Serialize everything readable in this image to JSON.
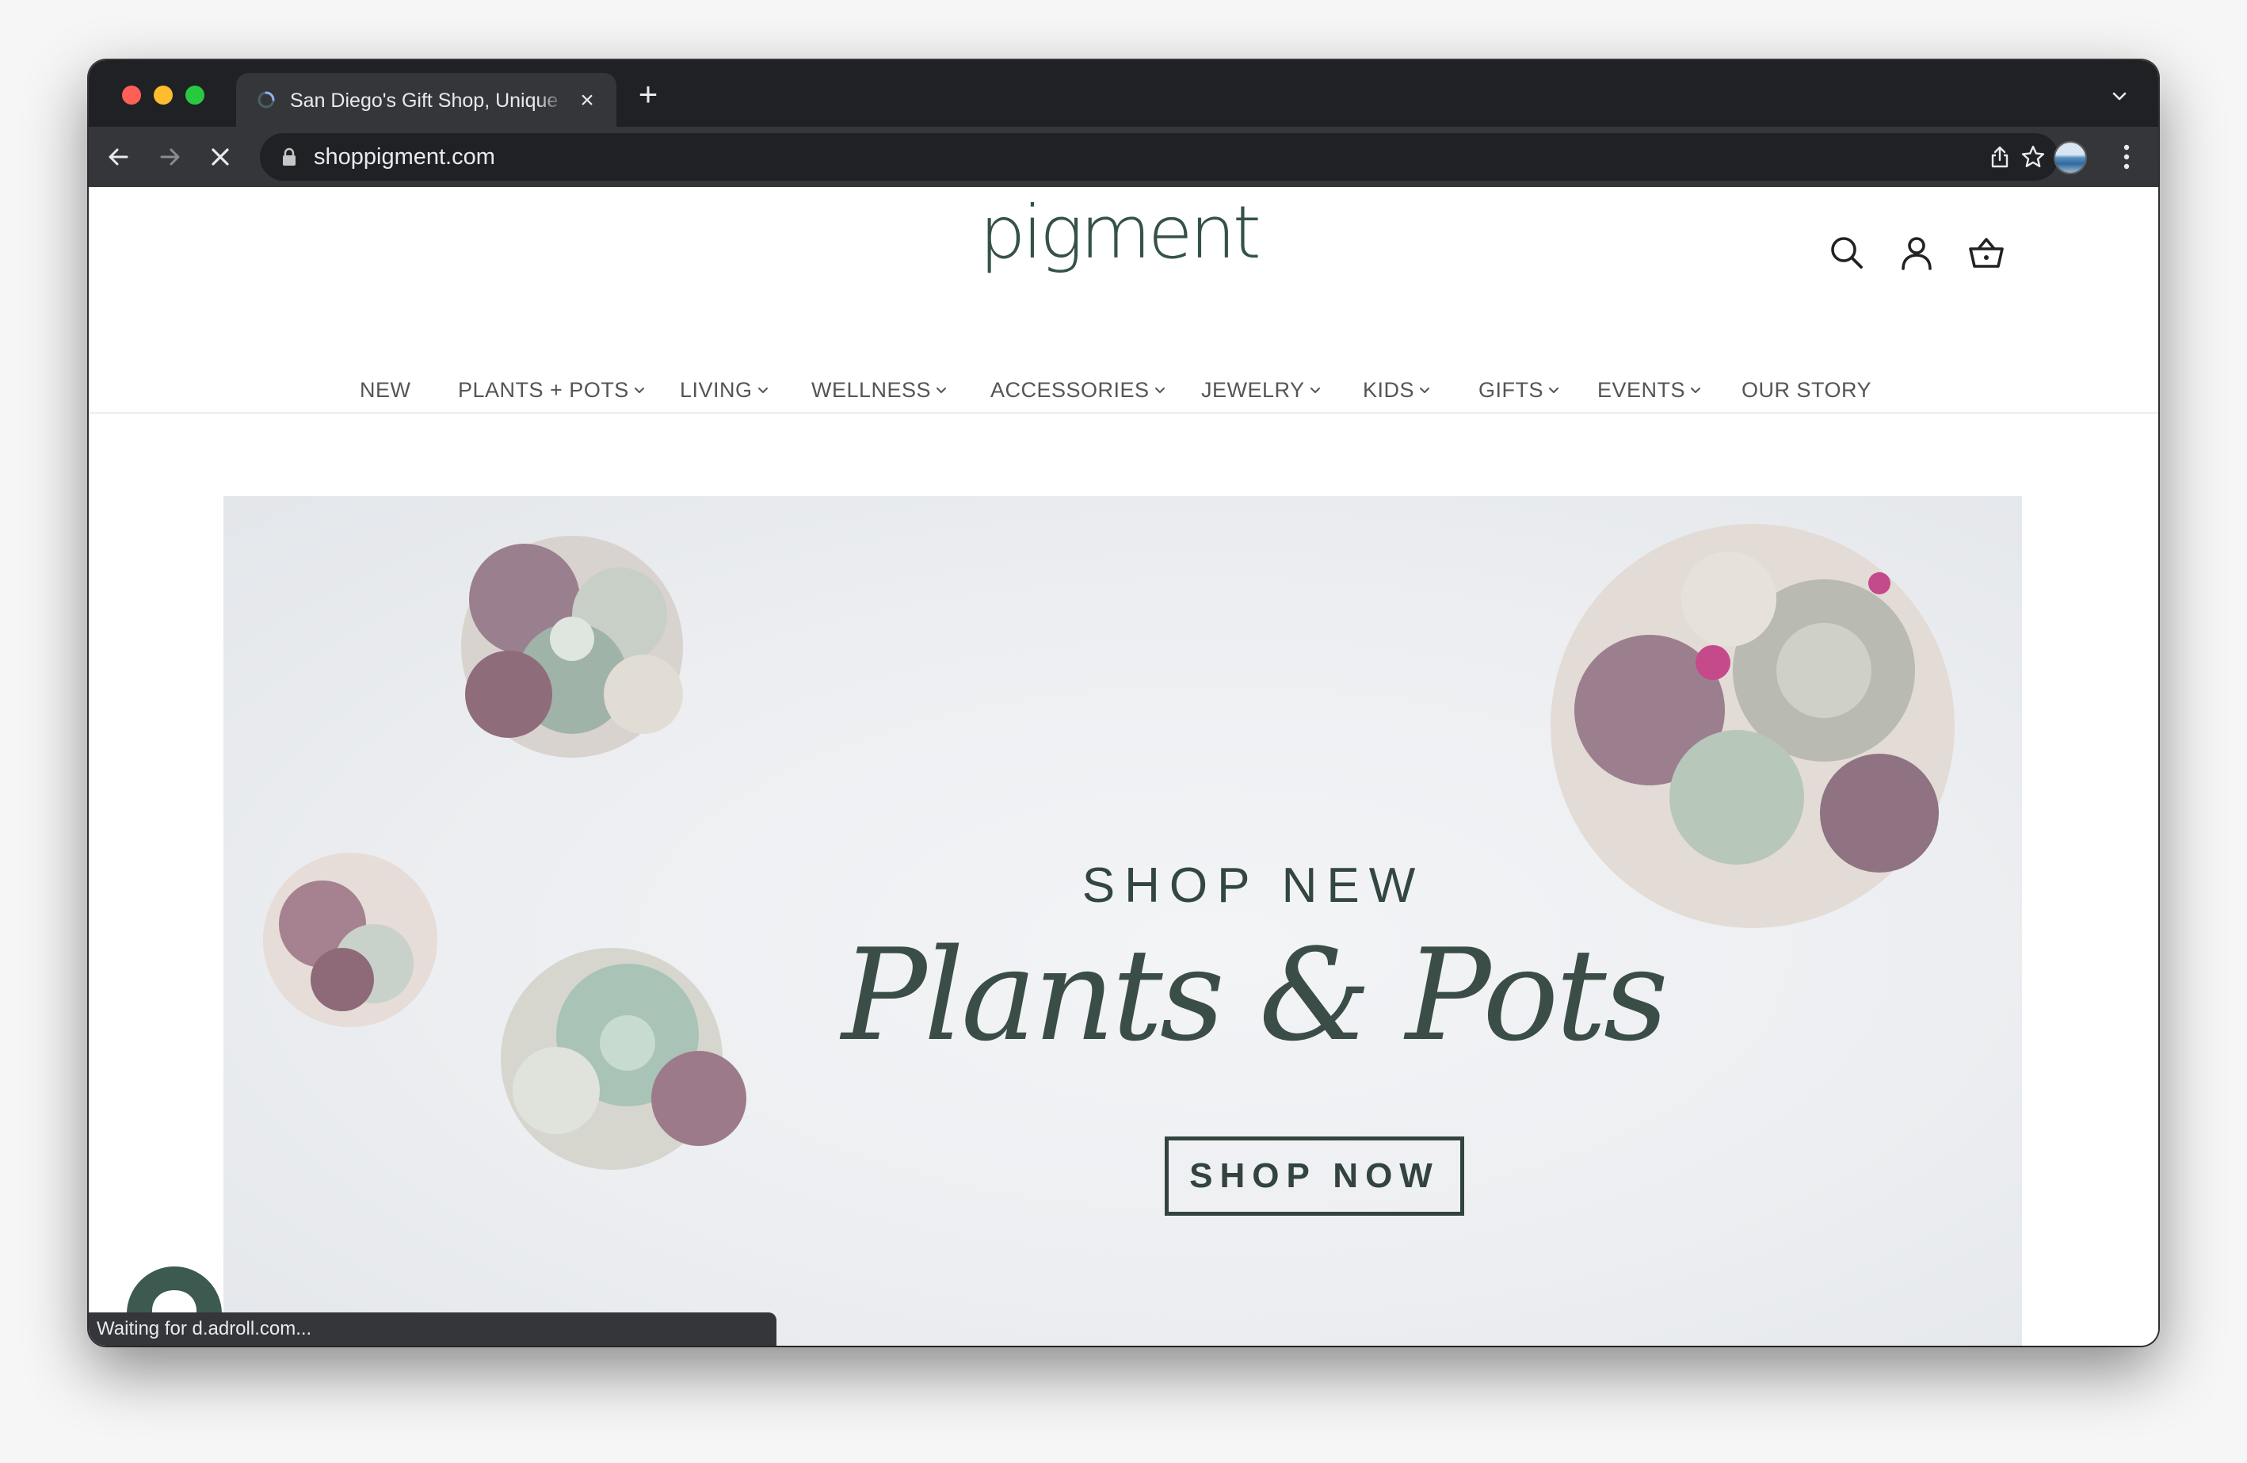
{
  "browser": {
    "tab": {
      "title": "San Diego's Gift Shop, Unique",
      "close_glyph": "×"
    },
    "new_tab_glyph": "+",
    "address_bar": {
      "url": "shoppigment.com"
    },
    "status_bar": "Waiting for d.adroll.com...",
    "icons": [
      "back-icon",
      "forward-icon",
      "stop-loading-icon",
      "lock-icon",
      "share-icon",
      "bookmark-star-icon",
      "profile-avatar",
      "more-menu-icon",
      "tab-search-icon",
      "loading-favicon"
    ]
  },
  "site": {
    "logo": "pigment",
    "header_icons": [
      "search-icon",
      "account-icon",
      "cart-basket-icon"
    ],
    "nav": [
      {
        "label": "NEW",
        "dropdown": false
      },
      {
        "label": "PLANTS + POTS",
        "dropdown": true
      },
      {
        "label": "LIVING",
        "dropdown": true
      },
      {
        "label": "WELLNESS",
        "dropdown": true
      },
      {
        "label": "ACCESSORIES",
        "dropdown": true
      },
      {
        "label": "JEWELRY",
        "dropdown": true
      },
      {
        "label": "KIDS",
        "dropdown": true
      },
      {
        "label": "GIFTS",
        "dropdown": true
      },
      {
        "label": "EVENTS",
        "dropdown": true
      },
      {
        "label": "OUR STORY",
        "dropdown": false
      }
    ],
    "hero": {
      "subtitle": "SHOP NEW",
      "title": "Plants & Pots",
      "button": "SHOP NOW"
    },
    "chat_widget_icon": "chat-bubble-icon",
    "colors": {
      "brand_green": "#3d5a51",
      "text_dark": "#33433e",
      "nav_text": "#555555"
    }
  }
}
